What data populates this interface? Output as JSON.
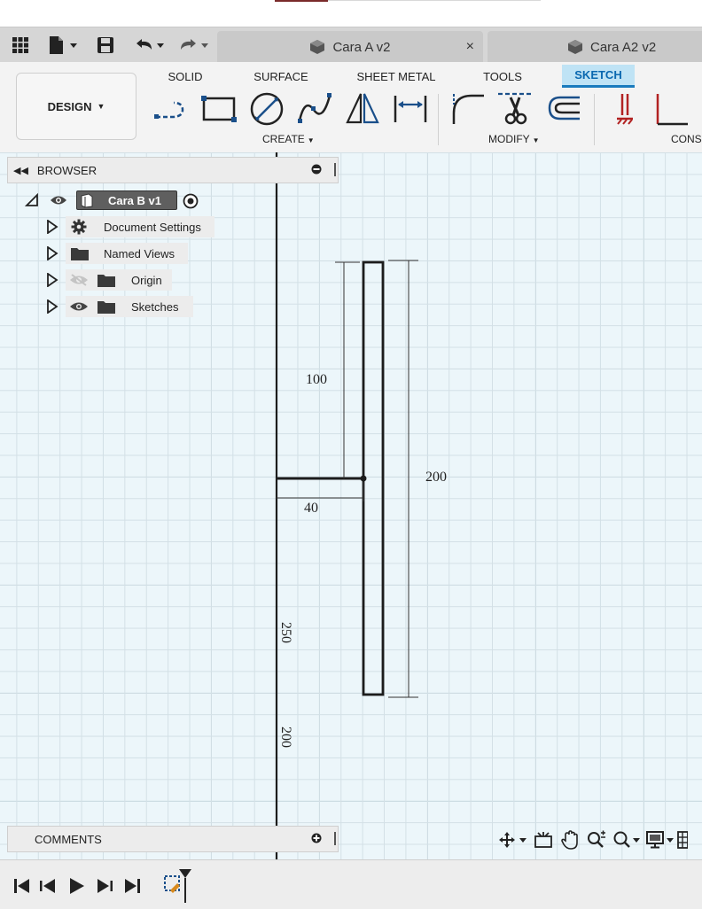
{
  "tabs": [
    {
      "label": "Cara A v2",
      "close": "×"
    },
    {
      "label": "Cara A2 v2"
    }
  ],
  "ribbon": {
    "workspace": "DESIGN",
    "tabs": [
      "SOLID",
      "SURFACE",
      "SHEET METAL",
      "TOOLS",
      "SKETCH"
    ],
    "active_tab": "SKETCH",
    "groups": [
      "CREATE",
      "MODIFY",
      "CONS"
    ]
  },
  "browser": {
    "title": "BROWSER",
    "root": "Cara B v1",
    "items": [
      {
        "label": "Document Settings",
        "icon": "gear-icon"
      },
      {
        "label": "Named Views",
        "icon": "folder-icon"
      },
      {
        "label": "Origin",
        "icon": "folder-icon",
        "hidden": true
      },
      {
        "label": "Sketches",
        "icon": "folder-icon"
      }
    ]
  },
  "comments": {
    "title": "COMMENTS"
  },
  "sketch": {
    "dimensions": {
      "vertical_left": "100",
      "horizontal": "40",
      "vertical_right": "200",
      "vertical_axis_1": "250",
      "vertical_axis_2": "200"
    }
  },
  "colors": {
    "accent": "#1a7bbd",
    "active_tab_bg": "#bfe3f5",
    "canvas_bg": "#ecf6fa",
    "grid_minor": "#d3e0e6",
    "grid_major": "#bdd0d8",
    "dimension_orange": "#d98a1c"
  }
}
